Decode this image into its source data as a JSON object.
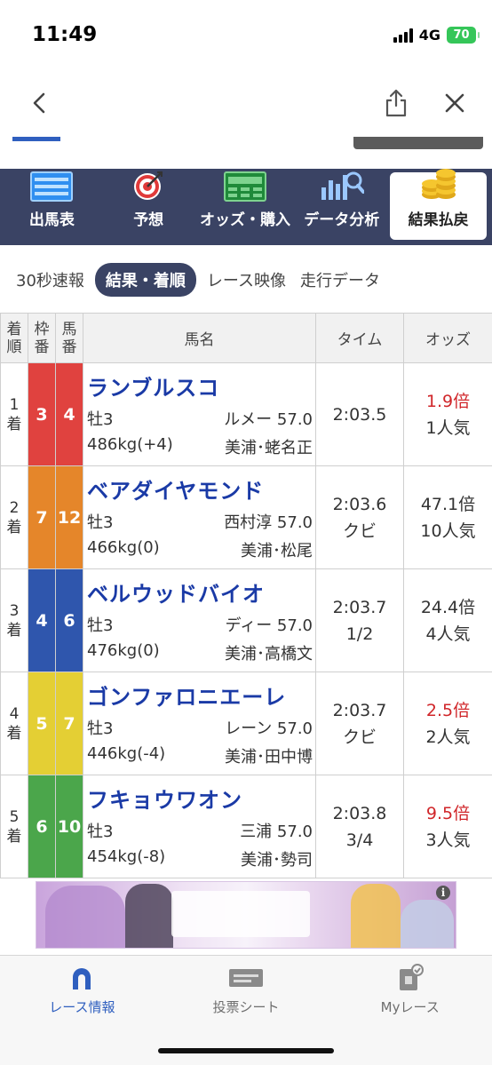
{
  "status": {
    "time": "11:49",
    "network": "4G",
    "battery": "70"
  },
  "main_nav": [
    {
      "label": "出馬表",
      "icon": "racecard-icon"
    },
    {
      "label": "予想",
      "icon": "target-icon"
    },
    {
      "label": "オッズ・購入",
      "icon": "ipat-icon"
    },
    {
      "label": "データ分析",
      "icon": "chart-search-icon"
    },
    {
      "label": "結果払戻",
      "icon": "coins-icon",
      "active": true
    }
  ],
  "sub_tabs": [
    "30秒速報",
    "結果・着順",
    "レース映像",
    "走行データ"
  ],
  "table": {
    "headers": {
      "rank": [
        "着",
        "順"
      ],
      "frame": [
        "枠",
        "番"
      ],
      "num": [
        "馬",
        "番"
      ],
      "name": "馬名",
      "time": "タイム",
      "odds": "オッズ"
    },
    "rows": [
      {
        "rank": "1",
        "rank_suffix": "着",
        "frame": "3",
        "num": "4",
        "name": "ランブルスコ",
        "sex_age": "牡3",
        "jockey_weight": "ルメー 57.0",
        "weight": "486kg(+4)",
        "trainer": "美浦･蛯名正",
        "time": "2:03.5",
        "margin": "",
        "odds": "1.9倍",
        "pop": "1人気",
        "odds_color": "red"
      },
      {
        "rank": "2",
        "rank_suffix": "着",
        "frame": "7",
        "num": "12",
        "name": "ベアダイヤモンド",
        "sex_age": "牡3",
        "jockey_weight": "西村淳 57.0",
        "weight": "466kg(0)",
        "trainer": "美浦･松尾",
        "time": "2:03.6",
        "margin": "クビ",
        "odds": "47.1倍",
        "pop": "10人気",
        "odds_color": "default"
      },
      {
        "rank": "3",
        "rank_suffix": "着",
        "frame": "4",
        "num": "6",
        "name": "ベルウッドバイオ",
        "sex_age": "牡3",
        "jockey_weight": "ディー 57.0",
        "weight": "476kg(0)",
        "trainer": "美浦･高橋文",
        "time": "2:03.7",
        "margin": "1/2",
        "odds": "24.4倍",
        "pop": "4人気",
        "odds_color": "default"
      },
      {
        "rank": "4",
        "rank_suffix": "着",
        "frame": "5",
        "num": "7",
        "name": "ゴンファロニエーレ",
        "sex_age": "牡3",
        "jockey_weight": "レーン 57.0",
        "weight": "446kg(-4)",
        "trainer": "美浦･田中博",
        "time": "2:03.7",
        "margin": "クビ",
        "odds": "2.5倍",
        "pop": "2人気",
        "odds_color": "red"
      },
      {
        "rank": "5",
        "rank_suffix": "着",
        "frame": "6",
        "num": "10",
        "name": "フキョウワオン",
        "sex_age": "牡3",
        "jockey_weight": "三浦 57.0",
        "weight": "454kg(-8)",
        "trainer": "美浦･勢司",
        "time": "2:03.8",
        "margin": "3/4",
        "odds": "9.5倍",
        "pop": "3人気",
        "odds_color": "red"
      }
    ]
  },
  "bottom_tabs": [
    {
      "label": "レース情報",
      "icon": "horseshoe-icon",
      "active": true
    },
    {
      "label": "投票シート",
      "icon": "ipat-sheet-icon"
    },
    {
      "label": "Myレース",
      "icon": "my-race-icon"
    }
  ],
  "colors": {
    "navy": "#3a4364",
    "link_blue": "#1a3aa6",
    "odds_red": "#d0262a",
    "frame_3": "#e0423f",
    "frame_4": "#2f56ad",
    "frame_5": "#e4cf34",
    "frame_6": "#4ba64b",
    "frame_7": "#e5862a"
  }
}
